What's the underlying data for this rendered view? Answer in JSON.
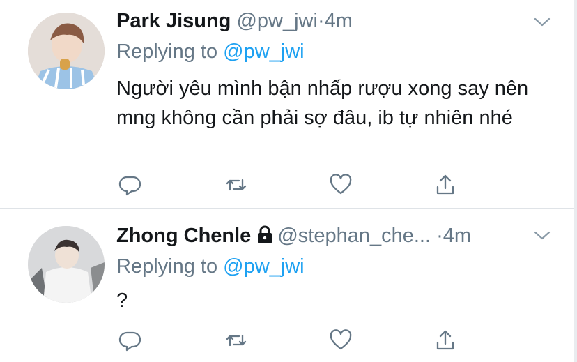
{
  "tweets": [
    {
      "name": "Park Jisung",
      "handle": "@pw_jwi",
      "separator": "·",
      "time": "4m",
      "replying_prefix": "Replying to ",
      "replying_to": "@pw_jwi",
      "text": "Người yêu mình bận nhấp rượu xong say nên mng không cần phải sợ đâu, ib tự nhiên nhé",
      "locked": false
    },
    {
      "name": "Zhong Chenle",
      "handle": "@stephan_che...",
      "separator": "·",
      "time": "4m",
      "replying_prefix": "Replying to ",
      "replying_to": "@pw_jwi",
      "text": "?",
      "locked": true
    }
  ],
  "icons": {
    "reply": "reply-icon",
    "retweet": "retweet-icon",
    "like": "like-icon",
    "share": "share-icon",
    "more": "chevron-down-icon",
    "lock": "lock-icon"
  },
  "colors": {
    "text": "#14171a",
    "secondary": "#657786",
    "link": "#1da1f2",
    "divider": "#dfe3e7"
  }
}
